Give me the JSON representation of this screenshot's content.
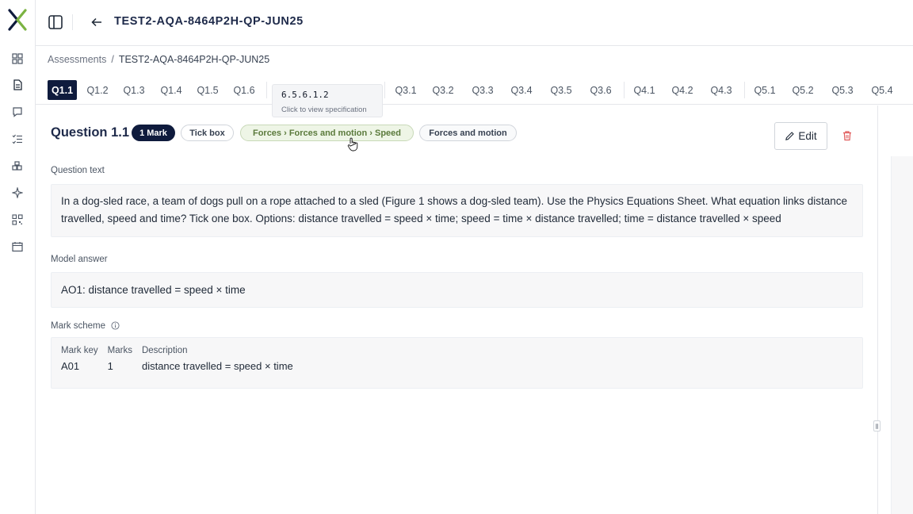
{
  "header": {
    "title": "TEST2-AQA-8464P2H-QP-JUN25"
  },
  "breadcrumb": {
    "root": "Assessments",
    "separator": "/",
    "current": "TEST2-AQA-8464P2H-QP-JUN25"
  },
  "tabs": [
    "Q1.1",
    "Q1.2",
    "Q1.3",
    "Q1.4",
    "Q1.5",
    "Q1.6",
    "Q3.1",
    "Q3.2",
    "Q3.3",
    "Q3.4",
    "Q3.5",
    "Q3.6",
    "Q4.1",
    "Q4.2",
    "Q4.3",
    "Q5.1",
    "Q5.2",
    "Q5.3",
    "Q5.4"
  ],
  "active_tab": "Q1.1",
  "tooltip": {
    "code": "6.5.6.1.2",
    "hint": "Click to view specification"
  },
  "question": {
    "title": "Question 1.1",
    "marks_chip": "1 Mark",
    "type_chip": "Tick box",
    "spec_chip": "Forces › Forces and motion › Speed",
    "topic_chip": "Forces and motion",
    "edit_label": "Edit",
    "text_label": "Question text",
    "text": "In a dog-sled race, a team of dogs pull on a rope attached to a sled (Figure 1 shows a dog-sled team). Use the Physics Equations Sheet. What equation links distance travelled, speed and time? Tick one box. Options: distance travelled = speed × time; speed = time × distance travelled; time = distance travelled × speed",
    "answer_label": "Model answer",
    "answer": "AO1: distance travelled = speed × time",
    "scheme_label": "Mark scheme",
    "scheme": {
      "headers": [
        "Mark key",
        "Marks",
        "Description"
      ],
      "rows": [
        {
          "key": "A01",
          "marks": "1",
          "description": "distance travelled = speed × time"
        }
      ]
    }
  },
  "colors": {
    "navy": "#0f1b3d",
    "spec_green": "#5b7a3c",
    "delete_red": "#e05a5a",
    "logo_green": "#7bb342"
  },
  "icons": [
    "logo-icon",
    "dashboard-icon",
    "document-icon",
    "chat-icon",
    "checklist-icon",
    "add-widget-icon",
    "sparkle-icon",
    "qr-code-icon",
    "calendar-icon",
    "panel-toggle-icon",
    "arrow-left-icon",
    "pencil-icon",
    "trash-icon",
    "info-icon",
    "pointer-cursor-icon",
    "drag-handle-icon"
  ]
}
